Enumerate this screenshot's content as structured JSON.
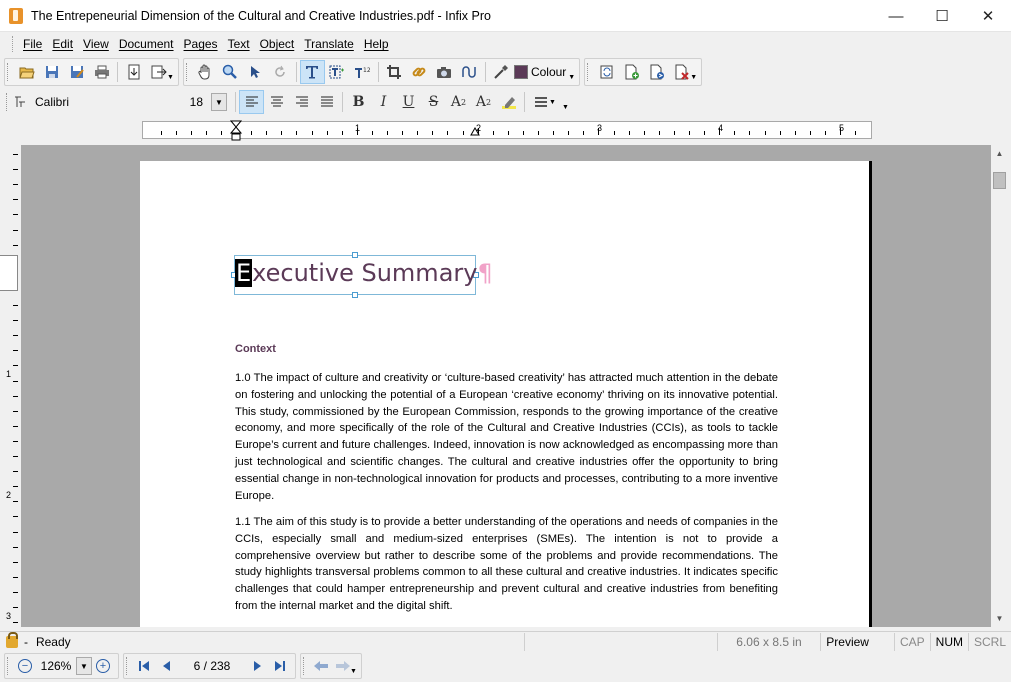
{
  "window": {
    "title": "The Entrepeneurial Dimension of the Cultural and Creative Industries.pdf - Infix Pro",
    "minimize": "—",
    "maximize": "☐",
    "close": "✕"
  },
  "menu": [
    "File",
    "Edit",
    "View",
    "Document",
    "Pages",
    "Text",
    "Object",
    "Translate",
    "Help"
  ],
  "toolbar": {
    "colour_label": "Colour",
    "colour_swatch": "#5b3a57"
  },
  "format_bar": {
    "font_name": "Calibri",
    "font_size": "18"
  },
  "ruler": {
    "top_numbers": [
      "1",
      "2",
      "3",
      "4",
      "5"
    ],
    "left_numbers": [
      "1",
      "2",
      "3"
    ]
  },
  "document": {
    "heading_first_char": "E",
    "heading_rest": "xecutive Summary",
    "heading_pilcrow": "¶",
    "section_label": "Context",
    "para1": "1.0 The impact of culture and creativity or ‘culture-based creativity’ has attracted much attention in the debate on fostering and unlocking the potential of a European ‘creative economy’ thriving on its innovative potential. This study, commissioned by the European Commission, responds to the growing importance of the creative economy, and more specifically of the role of the Cultural and Creative Industries (CCIs), as tools to tackle Europe’s current and future challenges. Indeed, innovation is now acknowledged as encompassing more than just technological and scientific changes. The cultural and creative industries offer the opportunity to bring essential change in non-technological innovation for products and processes, contributing to a more inventive Europe.",
    "para2": "1.1 The aim of this study is to provide a better understanding of the operations and needs of companies in the CCIs, especially small and medium-sized enterprises (SMEs). The intention is not to provide a comprehensive overview but rather to describe some of the problems and provide recommendations. The study highlights transversal problems common to all these cultural and creative industries. It indicates specific challenges that could hamper entrepreneurship and prevent cultural and creative industries from benefiting from the internal market and the digital shift."
  },
  "status": {
    "dash": "-",
    "state": "Ready",
    "page_size": "6.06 x 8.5 in",
    "mode": "Preview",
    "cap": "CAP",
    "num": "NUM",
    "scrl": "SCRL"
  },
  "navigation": {
    "zoom": "126%",
    "page": "6 / 238"
  }
}
